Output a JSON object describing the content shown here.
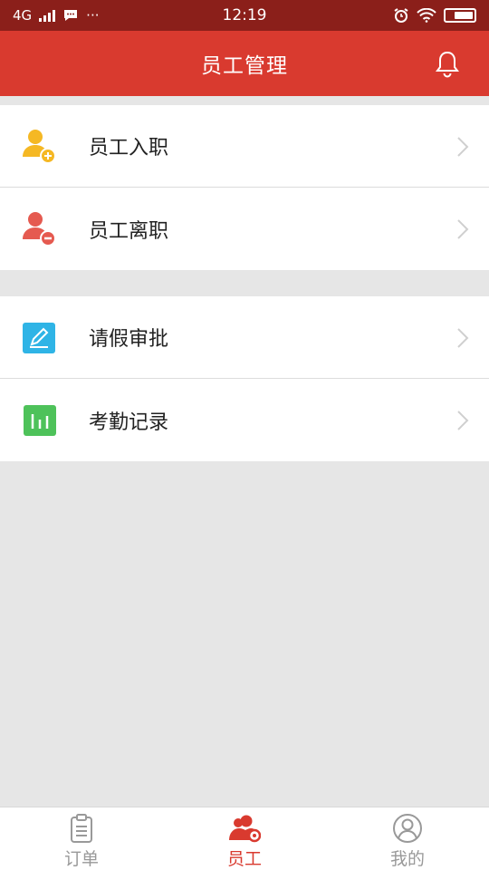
{
  "status_bar": {
    "network": "4G",
    "notification_glyph": "···",
    "time": "12:19"
  },
  "header": {
    "title": "员工管理"
  },
  "menu_groups": [
    {
      "items": [
        {
          "label": "员工入职",
          "icon": "user-add-icon",
          "color": "#f5b824"
        },
        {
          "label": "员工离职",
          "icon": "user-remove-icon",
          "color": "#e55a50"
        }
      ]
    },
    {
      "items": [
        {
          "label": "请假审批",
          "icon": "edit-icon",
          "color": "#2fb4e6"
        },
        {
          "label": "考勤记录",
          "icon": "bar-chart-icon",
          "color": "#4ec25a"
        }
      ]
    }
  ],
  "tabbar": {
    "tabs": [
      {
        "label": "订单",
        "icon": "clipboard-icon",
        "active": false
      },
      {
        "label": "员工",
        "icon": "users-gear-icon",
        "active": true
      },
      {
        "label": "我的",
        "icon": "profile-icon",
        "active": false
      }
    ]
  },
  "colors": {
    "header_bg": "#d93a2f",
    "status_bg": "#8b1f1a",
    "active_tab": "#d93a2f",
    "inactive_tab": "#999999",
    "page_bg": "#e6e6e6"
  }
}
